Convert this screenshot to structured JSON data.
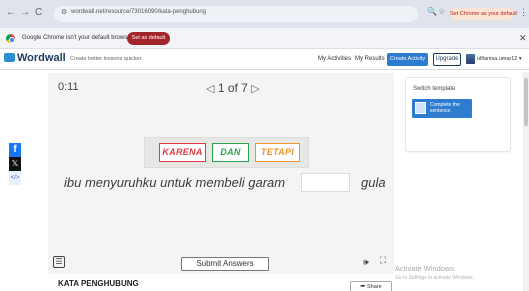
{
  "browser": {
    "back": "←",
    "forward": "→",
    "reload": "C",
    "url": "wordwall.net/resource/73016090/kata-penghubung",
    "default_pill": "Set Chrome as your default",
    "infobar_text": "Google Chrome isn't your default browser",
    "infobar_button": "Set as default",
    "close": "✕",
    "kebab": "⋮"
  },
  "header": {
    "logo": "Wordwall",
    "tagline": "Create better lessons quicker",
    "my_activities": "My Activities",
    "my_results": "My Results",
    "create_activity": "Create Activity",
    "upgrade": "Upgrade",
    "user": "ulfianisa.umar12 ▾"
  },
  "share": {
    "facebook": "f",
    "x": "𝕏",
    "embed": "</>"
  },
  "game": {
    "timer": "0:11",
    "page": "1 of 7",
    "prev": "◁",
    "next": "▷",
    "words": [
      {
        "text": "KARENA",
        "color": "#e53946"
      },
      {
        "text": "DAN",
        "color": "#2aa34a"
      },
      {
        "text": "TETAPI",
        "color": "#f0922b"
      }
    ],
    "sentence_part1": "ibu menyuruhku untuk membeli garam",
    "sentence_part2": "gula",
    "menu": "☰",
    "submit": "Submit Answers",
    "sound": "🕪",
    "fullscreen": "⛶"
  },
  "side_panel": {
    "switch_template": "Switch template",
    "template_name": "Complete the sentence"
  },
  "footer": {
    "activity_title": "KATA PENGHUBUNG",
    "share_button": "⮫ Share"
  },
  "watermark": {
    "line1": "Activate Windows",
    "line2": "Go to Settings to activate Windows."
  }
}
